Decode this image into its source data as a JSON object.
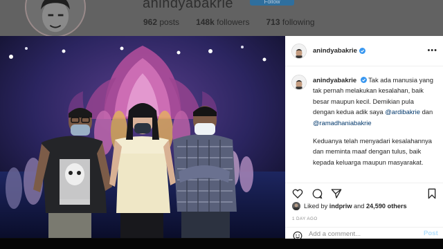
{
  "profile": {
    "username": "anindyabakrie",
    "follow_label": "Follow",
    "stats": [
      {
        "count": "962",
        "label": "posts"
      },
      {
        "count": "148k",
        "label": "followers"
      },
      {
        "count": "713",
        "label": "following"
      }
    ]
  },
  "post": {
    "username": "anindyabakrie",
    "verified": true,
    "more_icon": "more-horizontal-icon",
    "caption": {
      "username": "anindyabakrie",
      "para1_text": "Tak ada manusia yang tak pernah melakukan kesalahan, baik besar maupun kecil. Demikian pula dengan kedua adik saya",
      "mention1": "@ardibakrie",
      "connector": "dan",
      "mention2": "@ramadhaniabakrie",
      "para2": "Keduanya telah menyadari kesalahannya dan meminta maaf dengan tulus, baik kepada keluarga maupun masyarakat."
    },
    "actions": {
      "like_icon": "heart-icon",
      "comment_icon": "comment-icon",
      "share_icon": "share-icon",
      "save_icon": "bookmark-icon"
    },
    "likes": {
      "prefix": "Liked by",
      "liker": "indpriw",
      "and": "and",
      "others": "24,590 others"
    },
    "timestamp": "1 DAY AGO",
    "comment": {
      "placeholder": "Add a comment...",
      "post_label": "Post",
      "emoji_icon": "emoji-icon"
    }
  },
  "colors": {
    "link": "#00376b",
    "verified": "#3897f0",
    "post_button": "#b2dffc",
    "muted": "#8e8e8e"
  }
}
